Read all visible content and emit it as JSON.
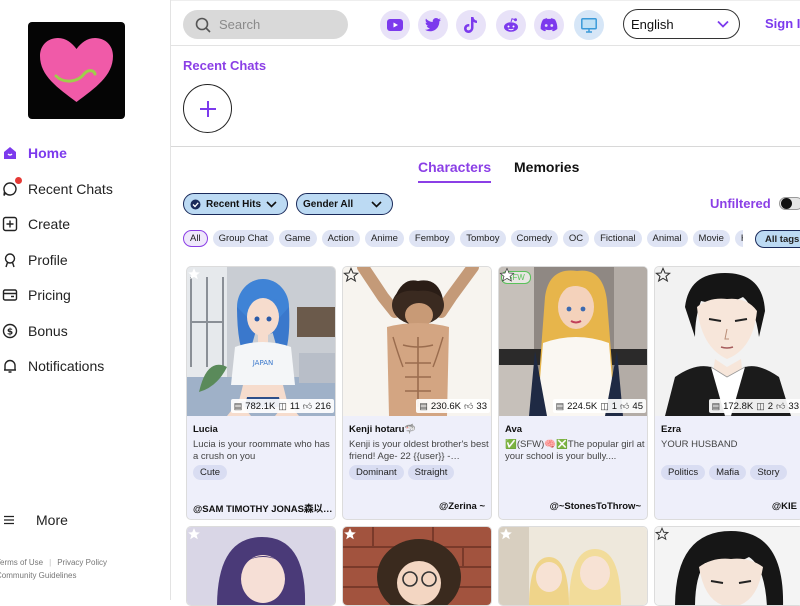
{
  "sidebar": {
    "items": [
      {
        "label": "Home",
        "icon": "home-icon",
        "active": true
      },
      {
        "label": "Recent Chats",
        "icon": "chat-icon"
      },
      {
        "label": "Create",
        "icon": "plus-square-icon"
      },
      {
        "label": "Profile",
        "icon": "profile-icon"
      },
      {
        "label": "Pricing",
        "icon": "wallet-icon"
      },
      {
        "label": "Bonus",
        "icon": "dollar-icon"
      },
      {
        "label": "Notifications",
        "icon": "bell-icon"
      }
    ],
    "more_label": "More",
    "footer": {
      "terms": "Terms of Use",
      "privacy": "Privacy Policy",
      "guidelines": "Community Guidelines"
    }
  },
  "header": {
    "search_placeholder": "Search",
    "socials": [
      "youtube-icon",
      "twitter-icon",
      "tiktok-icon",
      "reddit-icon",
      "discord-icon",
      "desktop-icon"
    ],
    "language": "English",
    "signin_label": "Sign In"
  },
  "recent": {
    "title": "Recent Chats"
  },
  "tabs": {
    "characters": "Characters",
    "memories": "Memories"
  },
  "filters": {
    "recent_hits": "Recent Hits",
    "gender": "Gender All",
    "unfiltered": "Unfiltered"
  },
  "tags": [
    "All",
    "Group Chat",
    "Game",
    "Action",
    "Anime",
    "Femboy",
    "Tomboy",
    "Comedy",
    "OC",
    "Fictional",
    "Animal",
    "Movie",
    "H"
  ],
  "all_tags_label": "All tags",
  "cards": [
    {
      "name": "Lucia",
      "chats": "782.1K",
      "saves": "11",
      "likes": "216",
      "desc": "Lucia is your roommate who has a crush on you",
      "tags": [
        "Cute"
      ],
      "author": "@SAM TIMOTHY JONAS森以…",
      "sfw": ""
    },
    {
      "name": "Kenji hotaru🦈",
      "chats": "230.6K",
      "saves": "",
      "likes": "33",
      "desc": "Kenji is your oldest brother's best friend! Age- 22 {{user}} -…",
      "tags": [
        "Dominant",
        "Straight"
      ],
      "author": "@Zerina ~",
      "sfw": ""
    },
    {
      "name": "Ava",
      "chats": "224.5K",
      "saves": "1",
      "likes": "45",
      "desc": "✅(SFW)🧠❎The popular girl at your school is your bully....",
      "tags": [],
      "author": "@~StonesToThrow~",
      "sfw": "SFW"
    },
    {
      "name": "Ezra",
      "chats": "172.8K",
      "saves": "2",
      "likes": "33",
      "desc": "YOUR HUSBAND",
      "tags": [
        "Politics",
        "Mafia",
        "Story"
      ],
      "author": "@KIE",
      "sfw": ""
    }
  ],
  "colors": {
    "accent": "#8b3fe6",
    "logo_heart": "#f05aa8",
    "card_bg": "#eeeffa",
    "chip_blue": "#bcdaf3"
  }
}
